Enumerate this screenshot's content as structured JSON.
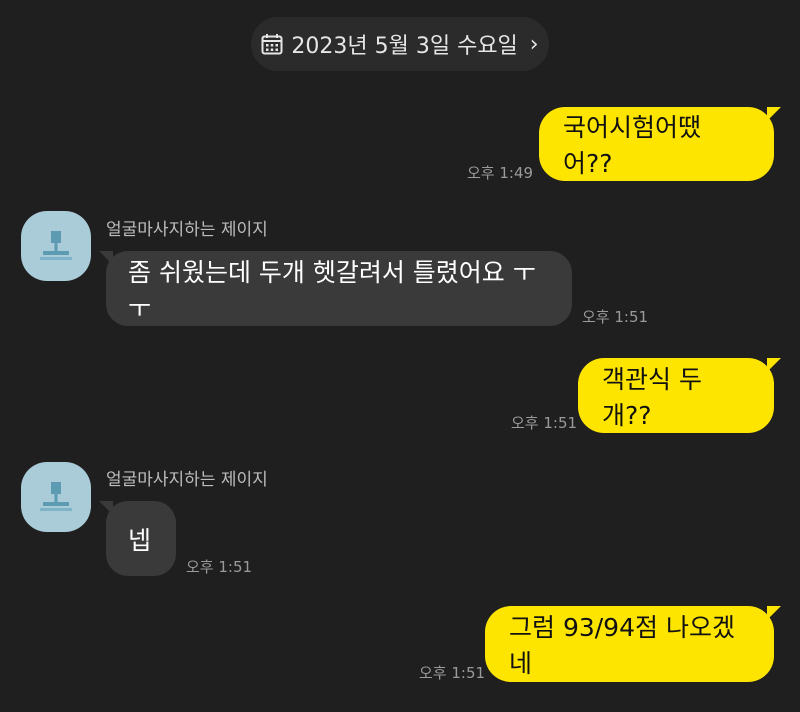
{
  "header": {
    "date": "2023년 5월 3일 수요일",
    "calendar_icon": "calendar-icon",
    "chevron": "›"
  },
  "messages": [
    {
      "from": "me",
      "text": "국어시험어땠어??",
      "time": "오후 1:49"
    },
    {
      "from": "other",
      "sender": "얼굴마사지하는 제이지",
      "text": "좀 쉬웠는데 두개 헷갈려서 틀렸어요 ㅜㅜ",
      "time": "오후 1:51"
    },
    {
      "from": "me",
      "text": "객관식 두 개??",
      "time": "오후 1:51"
    },
    {
      "from": "other",
      "sender": "얼굴마사지하는 제이지",
      "text": "넵",
      "time": "오후 1:51"
    },
    {
      "from": "me",
      "text": "그럼 93/94점 나오겠네",
      "time": "오후 1:51"
    }
  ],
  "colors": {
    "background": "#1f1f1f",
    "outgoing_bubble": "#fee500",
    "incoming_bubble": "#3a3a3a",
    "avatar": "#a9ccd8"
  }
}
